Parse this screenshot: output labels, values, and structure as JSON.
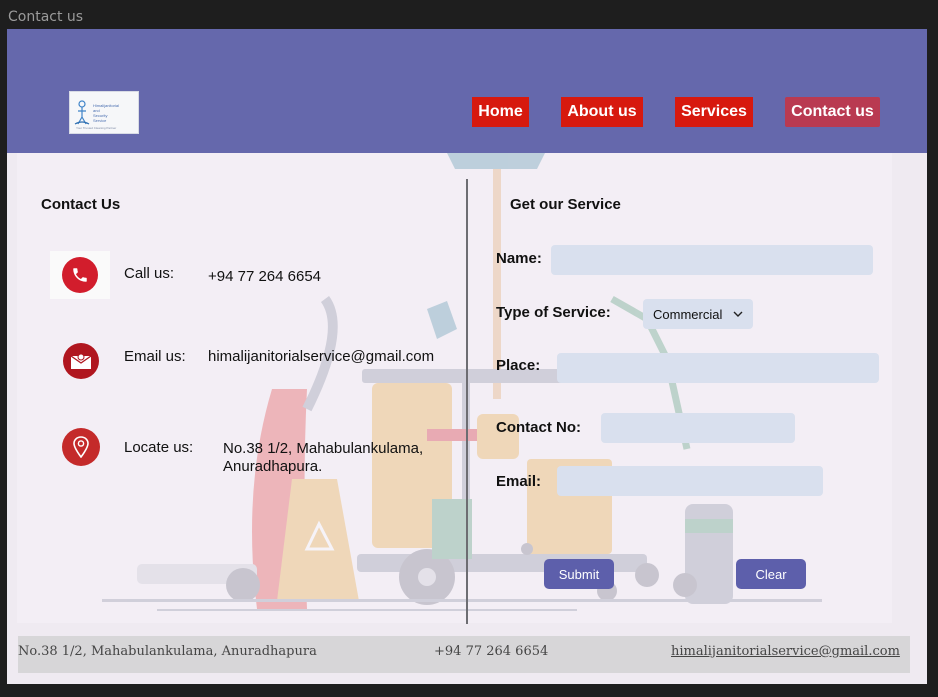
{
  "frame": {
    "title": "Contact us"
  },
  "header": {
    "logo": {
      "line1": "Himalijanitorial",
      "line2": "and",
      "line3": "Security",
      "line4": "Service",
      "tagline": "Your Trusted Cleaning Partner"
    },
    "nav": [
      {
        "label": "Home"
      },
      {
        "label": "About us"
      },
      {
        "label": "Services"
      },
      {
        "label": "Contact us"
      }
    ],
    "colors": {
      "header_bg": "#6568ac",
      "nav_bg": "#d7190e",
      "nav_active": "#b93a51"
    }
  },
  "contact": {
    "title": "Contact Us",
    "call": {
      "label": "Call us:",
      "value": "+94 77 264 6654",
      "icon": "phone-icon"
    },
    "email": {
      "label": "Email us:",
      "value": "himalijanitorialservice@gmail.com",
      "icon": "mail-icon"
    },
    "locate": {
      "label": "Locate us:",
      "value_line1": "No.38 1/2, Mahabulankulama,",
      "value_line2": "Anuradhapura.",
      "icon": "location-pin-icon"
    }
  },
  "form": {
    "title": "Get our Service",
    "name_label": "Name:",
    "type_label": "Type of Service:",
    "type_selected": "Commercial",
    "place_label": "Place:",
    "contact_label": "Contact No:",
    "email_label": "Email:",
    "submit_label": "Submit",
    "clear_label": "Clear"
  },
  "footer": {
    "address": "No.38 1/2, Mahabulankulama, Anuradhapura",
    "phone": "+94 77 264 6654",
    "email": "himalijanitorialservice@gmail.com"
  }
}
